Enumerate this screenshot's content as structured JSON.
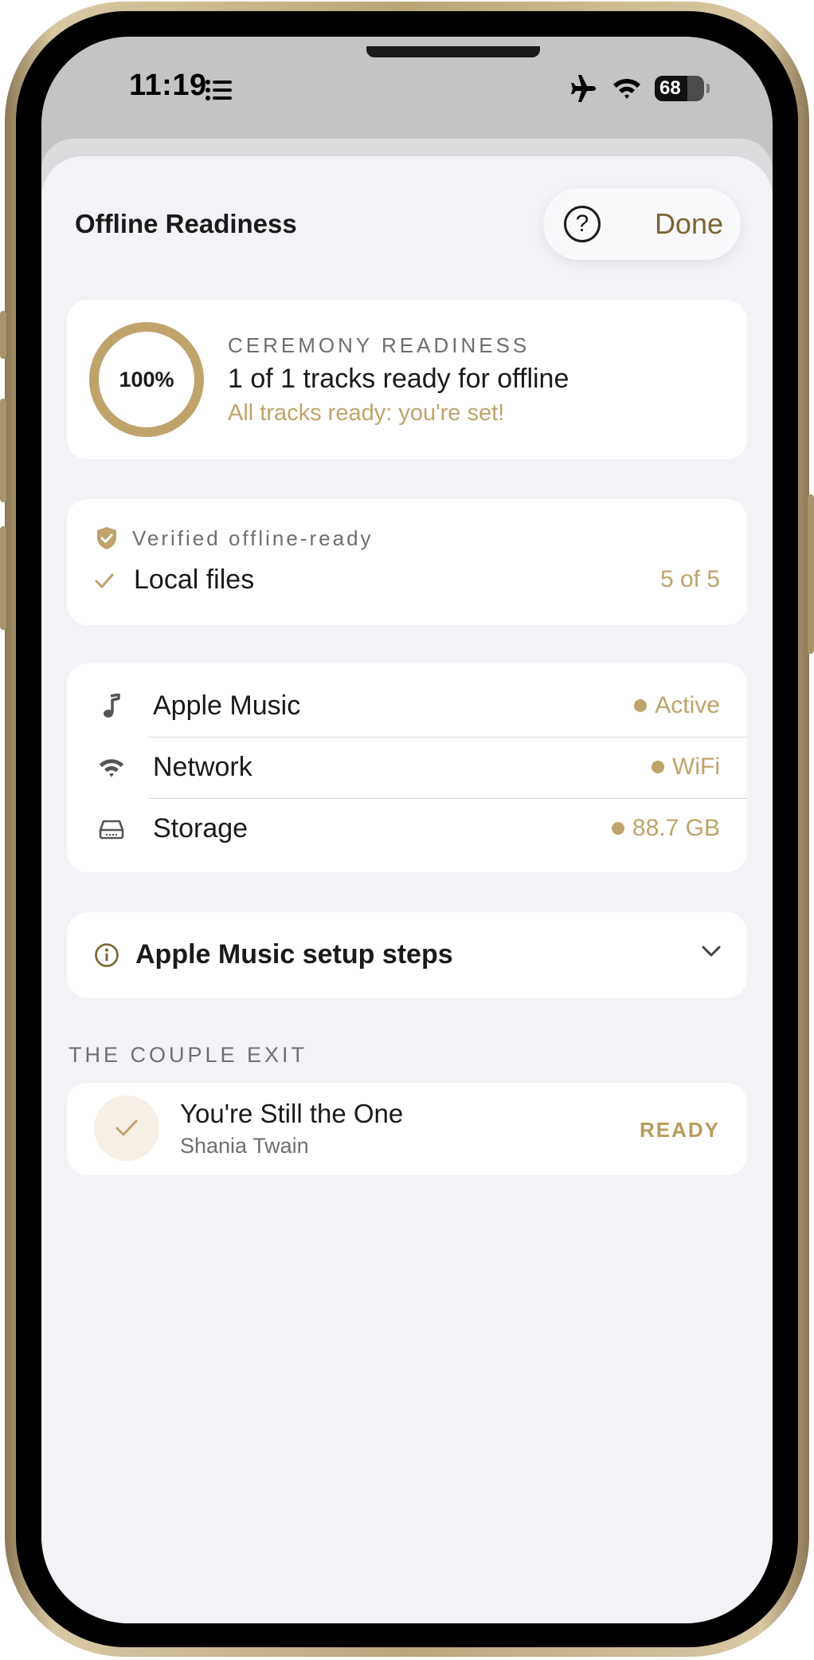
{
  "status_bar": {
    "time": "11:19",
    "battery": "68",
    "icons": [
      "list-icon",
      "airplane-icon",
      "wifi-icon",
      "battery-icon"
    ]
  },
  "nav": {
    "title": "Offline Readiness",
    "help_icon": "question-circle-icon",
    "done_label": "Done"
  },
  "readiness": {
    "percent_label": "100%",
    "percent_value": 1.0,
    "caption": "CEREMONY READINESS",
    "summary": "1 of 1 tracks ready for offline",
    "message": "All tracks ready: you're set!"
  },
  "verification": {
    "badge_label": "Verified offline-ready",
    "item_label": "Local files",
    "item_count": "5 of 5"
  },
  "services": [
    {
      "icon": "music-note-icon",
      "label": "Apple Music",
      "value": "Active"
    },
    {
      "icon": "wifi-icon",
      "label": "Network",
      "value": "WiFi"
    },
    {
      "icon": "storage-drive-icon",
      "label": "Storage",
      "value": "88.7 GB"
    }
  ],
  "setup": {
    "label": "Apple Music setup steps",
    "icon": "info-circle-icon"
  },
  "section": {
    "header": "THE COUPLE EXIT",
    "tracks": [
      {
        "title": "You're Still the One",
        "artist": "Shania Twain",
        "status": "READY"
      }
    ]
  },
  "colors": {
    "accent_gold": "#c0a36b",
    "accent_dark_gold": "#7a6532",
    "sheet_bg": "#f2f2f7",
    "card_bg": "#ffffff"
  }
}
